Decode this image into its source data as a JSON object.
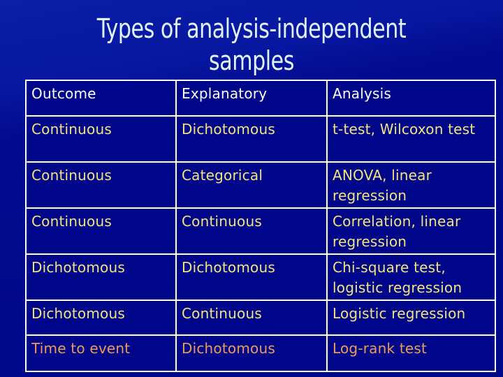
{
  "slide": {
    "title_line1": "Types of analysis-independent",
    "title_line2": "samples"
  },
  "table": {
    "headers": [
      "Outcome",
      "Explanatory",
      "Analysis"
    ],
    "rows": [
      {
        "outcome": "Continuous",
        "explanatory": "Dichotomous",
        "analysis": "t-test, Wilcoxon test"
      },
      {
        "outcome": "Continuous",
        "explanatory": "Categorical",
        "analysis": "ANOVA, linear regression"
      },
      {
        "outcome": "Continuous",
        "explanatory": "Continuous",
        "analysis": "Correlation, linear regression"
      },
      {
        "outcome": "Dichotomous",
        "explanatory": "Dichotomous",
        "analysis": "Chi-square test, logistic regression"
      },
      {
        "outcome": "Dichotomous",
        "explanatory": "Continuous",
        "analysis": "Logistic regression"
      },
      {
        "outcome": "Time to event",
        "explanatory": "Dichotomous",
        "analysis": "Log-rank test"
      }
    ]
  },
  "colors": {
    "background": "#000a88",
    "title_text": "#e4f4ff",
    "header_text": "#ffffff",
    "body_text": "#f5e37e",
    "last_row_text": "#f09a5a",
    "grid": "#ffffff"
  }
}
